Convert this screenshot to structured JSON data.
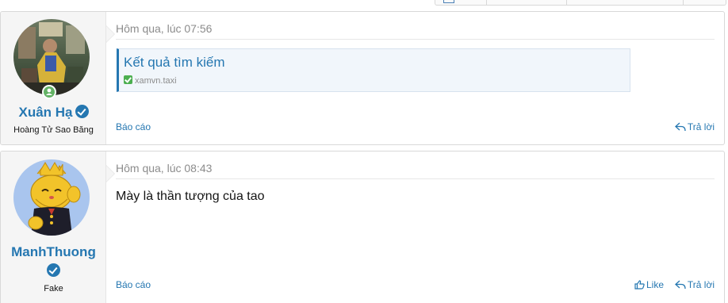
{
  "posts": [
    {
      "username": "Xuân Hạ",
      "user_title": "Hoàng Tử Sao Băng",
      "date": "Hôm qua, lúc 07:56",
      "embed": {
        "title": "Kết quả tìm kiếm",
        "url": "xamvn.taxi"
      },
      "report_label": "Báo cáo",
      "reply_label": "Trả lời"
    },
    {
      "username": "ManhThuong",
      "user_title": "Fake",
      "date": "Hôm qua, lúc 08:43",
      "message": "Mày là thần tượng của tao",
      "report_label": "Báo cáo",
      "like_label": "Like",
      "reply_label": "Trả lời"
    }
  ],
  "colors": {
    "link": "#2577b1",
    "online": "#63b265",
    "muted": "#8c8c8c"
  },
  "icons": [
    "online-status-icon",
    "verified-badge-icon",
    "checkbox-icon",
    "reply-icon",
    "like-icon"
  ]
}
